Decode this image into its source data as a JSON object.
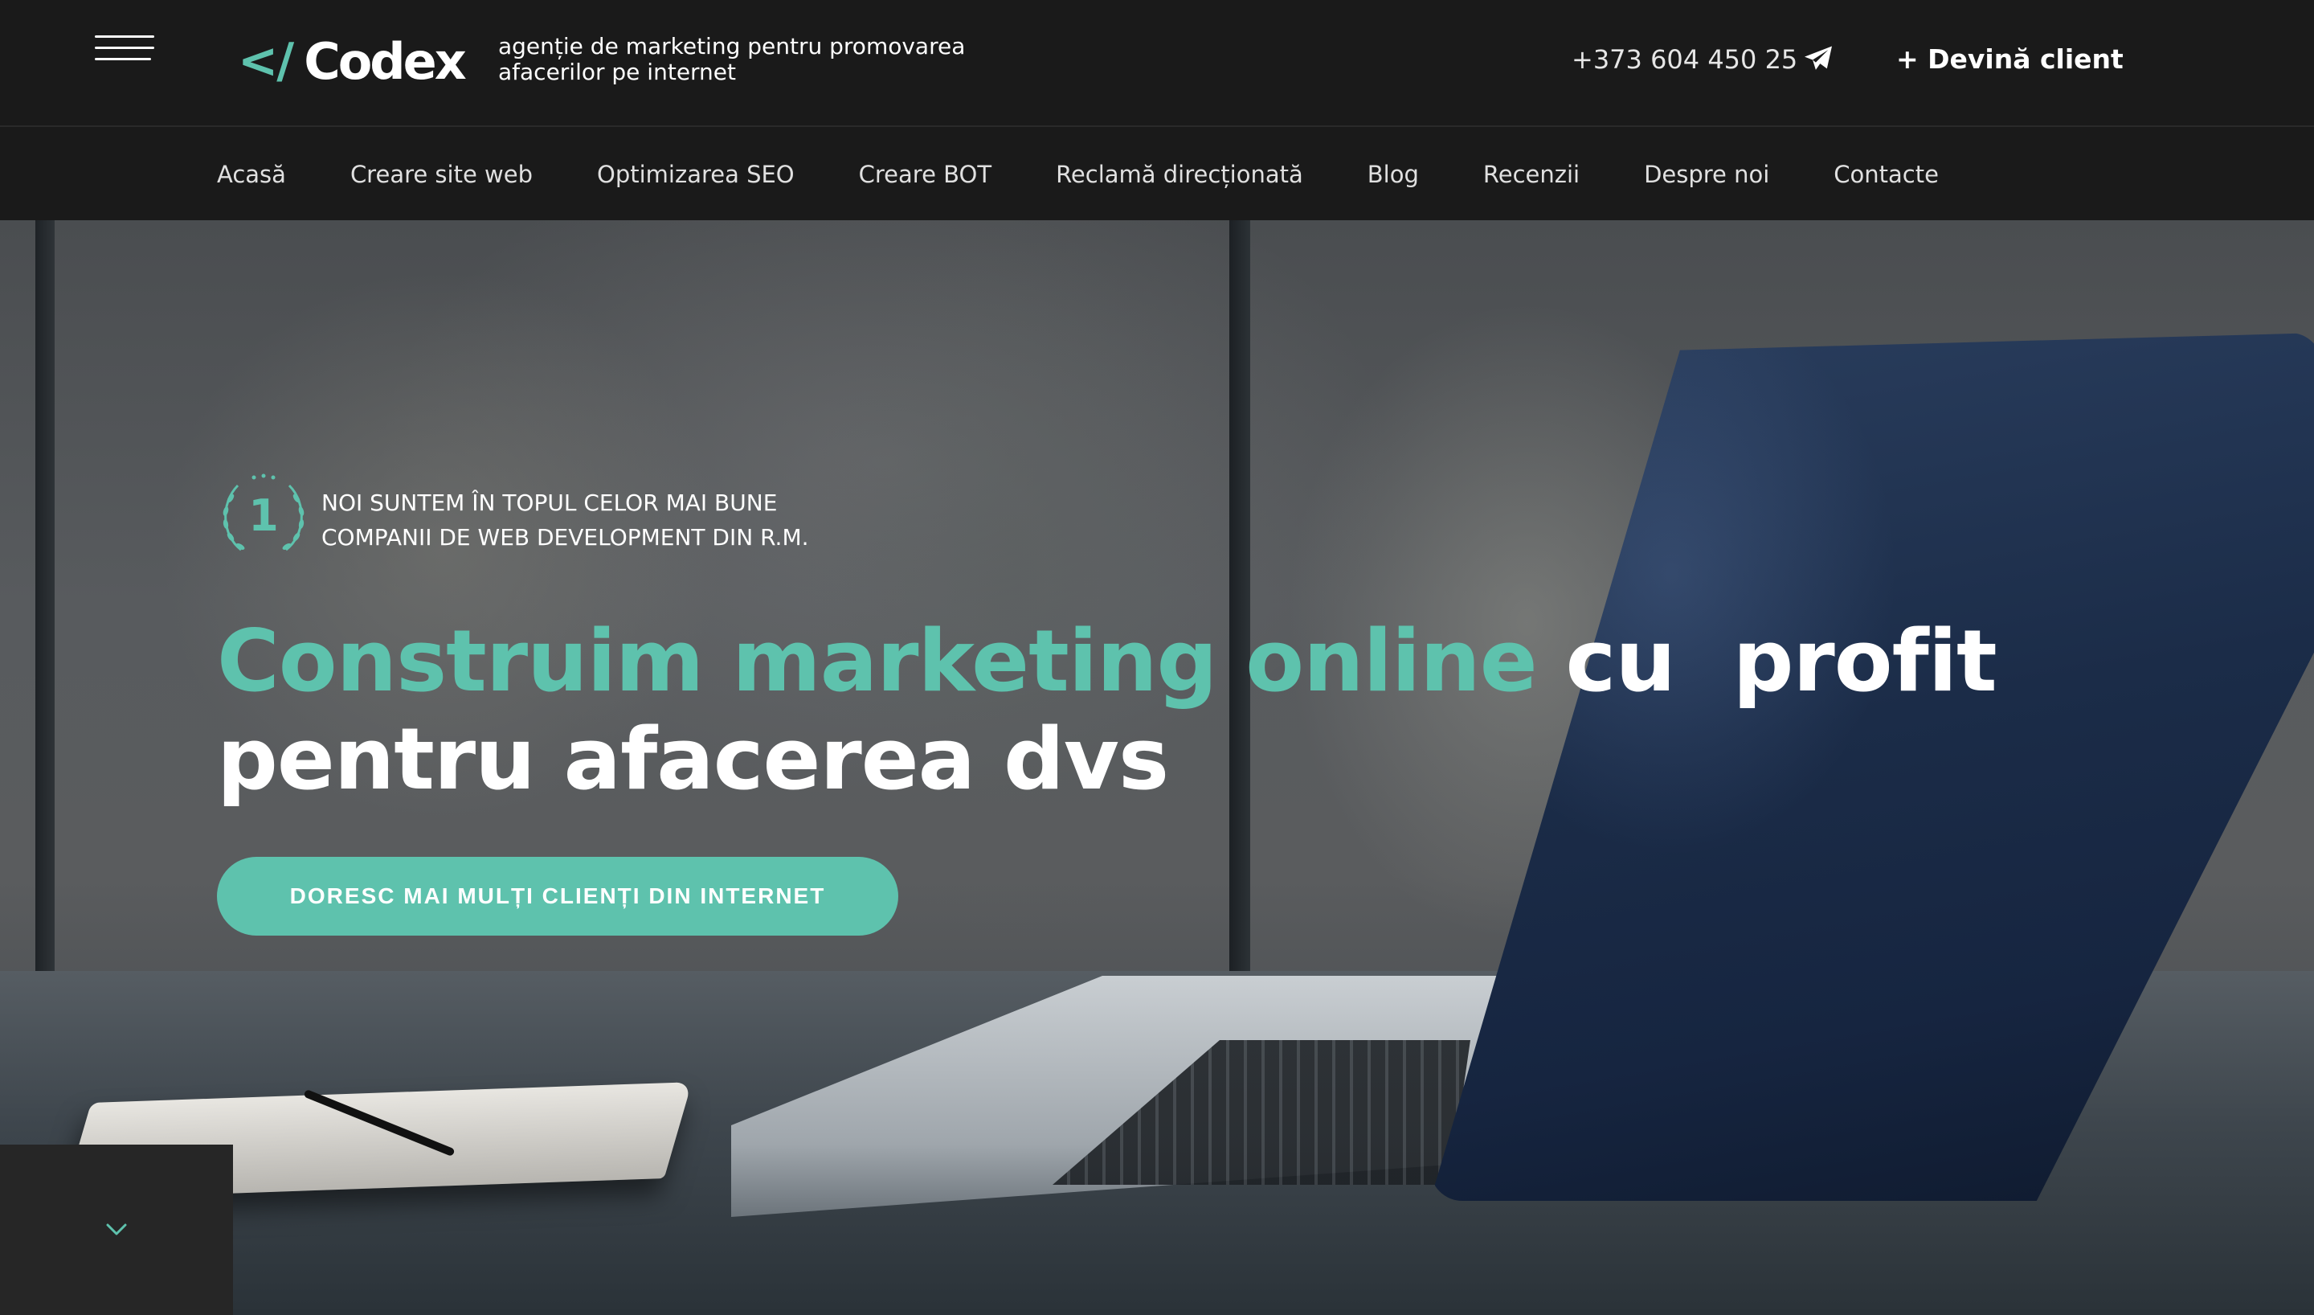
{
  "header": {
    "logo_mark": "</",
    "logo_text": "Codex",
    "tagline": "agenție de marketing pentru promovarea afacerilor pe internet",
    "phone": "+373 604 450 25",
    "cta_label": "+ Devină client",
    "icons": [
      "menu-icon",
      "telegram-icon"
    ]
  },
  "nav": {
    "items": [
      {
        "label": "Acasă"
      },
      {
        "label": "Creare site web"
      },
      {
        "label": "Optimizarea SEO"
      },
      {
        "label": "Creare BOT"
      },
      {
        "label": "Reclamă direcționată"
      },
      {
        "label": "Blog"
      },
      {
        "label": "Recenzii"
      },
      {
        "label": "Despre noi"
      },
      {
        "label": "Contacte"
      }
    ]
  },
  "hero": {
    "award_number": "1",
    "award_text_line1": "NOI SUNTEM ÎN TOPUL CELOR MAI BUNE",
    "award_text_line2": "COMPANII DE WEB DEVELOPMENT DIN R.M.",
    "headline_accent": "Construim marketing online",
    "headline_rest_1": " cu  profit",
    "headline_line2": "pentru afacerea dvs",
    "cta_label": "DORESC MAI MULȚI CLIENȚI DIN INTERNET"
  },
  "colors": {
    "accent": "#5ec2ad",
    "header_bg": "#1a1a1a",
    "text": "#ffffff"
  },
  "scroll": {
    "icon": "chevron-down-icon"
  }
}
